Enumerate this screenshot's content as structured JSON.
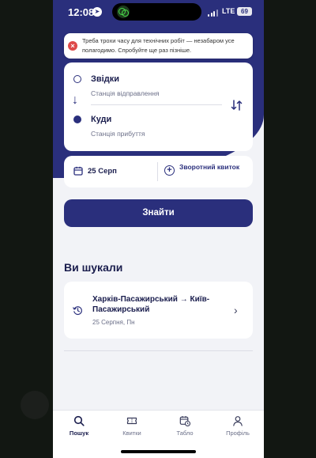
{
  "status_bar": {
    "time": "12:08",
    "network": "LTE",
    "battery": "69"
  },
  "alert": {
    "icon": "error-icon",
    "message": "Треба трохи часу для технічних робіт — незабаром усе полагодимо. Спробуйте ще раз пізніше."
  },
  "route": {
    "from_label": "Звідки",
    "from_placeholder": "Станція відправлення",
    "to_label": "Куди",
    "to_placeholder": "Станція прибуття"
  },
  "date": {
    "value": "25 Серп",
    "return_label": "Зворотний квиток"
  },
  "search_button": "Знайти",
  "history": {
    "title": "Ви шукали",
    "items": [
      {
        "route": "Харків-Пасажирський → Київ-Пасажирський",
        "date": "25 Серпня, Пн"
      }
    ]
  },
  "tabs": [
    {
      "label": "Пошук",
      "icon": "search-icon",
      "active": true
    },
    {
      "label": "Квитки",
      "icon": "ticket-icon",
      "active": false
    },
    {
      "label": "Табло",
      "icon": "schedule-icon",
      "active": false
    },
    {
      "label": "Профіль",
      "icon": "profile-icon",
      "active": false
    }
  ],
  "colors": {
    "primary": "#2a2f7c",
    "background": "#f2f3f7",
    "error": "#de4a4a"
  }
}
